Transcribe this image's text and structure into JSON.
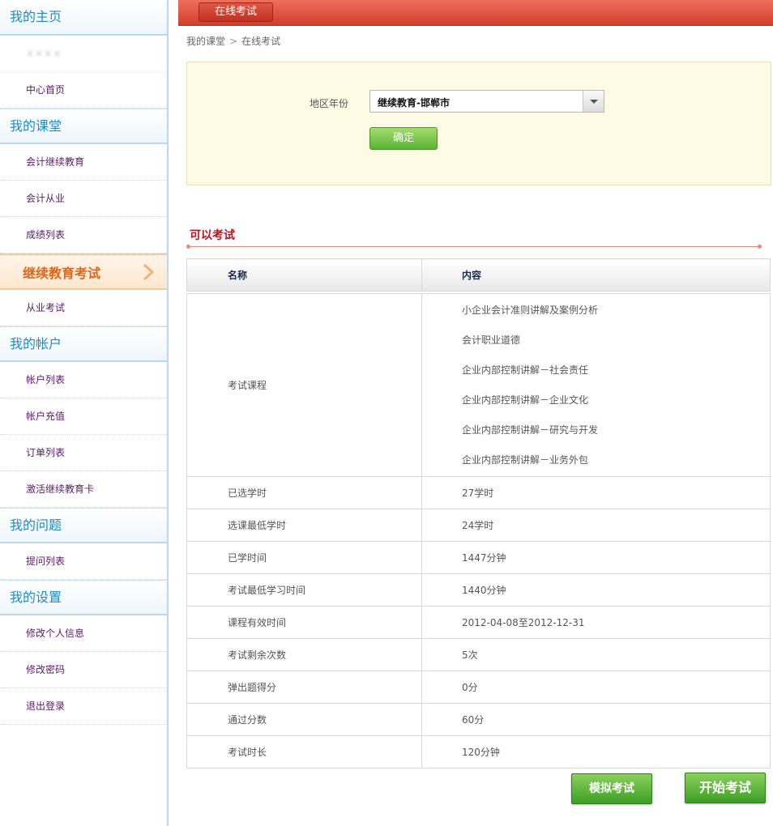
{
  "sidebar": {
    "sections": [
      {
        "title": "我的主页",
        "items": [
          {
            "label": "××××"
          },
          {
            "label": "中心首页"
          }
        ]
      },
      {
        "title": "我的课堂",
        "items": [
          {
            "label": "会计继续教育"
          },
          {
            "label": "会计从业"
          },
          {
            "label": "成绩列表"
          },
          {
            "label": "继续教育考试"
          },
          {
            "label": "从业考试"
          }
        ]
      },
      {
        "title": "我的帐户",
        "items": [
          {
            "label": "帐户列表"
          },
          {
            "label": "帐户充值"
          },
          {
            "label": "订单列表"
          },
          {
            "label": "激活继续教育卡"
          }
        ]
      },
      {
        "title": "我的问题",
        "items": [
          {
            "label": "提问列表"
          }
        ]
      },
      {
        "title": "我的设置",
        "items": [
          {
            "label": "修改个人信息"
          },
          {
            "label": "修改密码"
          },
          {
            "label": "退出登录"
          }
        ]
      }
    ]
  },
  "header": {
    "tab_label": "在线考试"
  },
  "breadcrumb": {
    "parent": "我的课堂",
    "separator": ">",
    "current": "在线考试"
  },
  "filter": {
    "label": "地区年份",
    "selected_value": "继续教育-邯郸市",
    "confirm_label": "确定"
  },
  "section": {
    "title": "可以考试"
  },
  "table": {
    "headers": {
      "name": "名称",
      "content": "内容"
    },
    "courses_label": "考试课程",
    "courses": [
      "小企业会计准则讲解及案例分析",
      "会计职业道德",
      "企业内部控制讲解－社会责任",
      "企业内部控制讲解－企业文化",
      "企业内部控制讲解－研究与开发",
      "企业内部控制讲解－业务外包"
    ],
    "rows": [
      {
        "name": "已选学时",
        "value": "27学时"
      },
      {
        "name": "选课最低学时",
        "value": "24学时"
      },
      {
        "name": "已学时间",
        "value": "1447分钟"
      },
      {
        "name": "考试最低学习时间",
        "value": "1440分钟"
      },
      {
        "name": "课程有效时间",
        "value": "2012-04-08至2012-12-31"
      },
      {
        "name": "考试剩余次数",
        "value": "5次"
      },
      {
        "name": "弹出题得分",
        "value": "0分"
      },
      {
        "name": "通过分数",
        "value": "60分"
      },
      {
        "name": "考试时长",
        "value": "120分钟"
      }
    ]
  },
  "actions": {
    "mock_exam_label": "模拟考试",
    "start_exam_label": "开始考试"
  },
  "colors": {
    "header_red": "#d23d2b",
    "sidebar_blue": "#1f8ac9",
    "active_orange": "#e0671a",
    "button_green": "#3d9e25",
    "section_red": "#c0121b"
  }
}
